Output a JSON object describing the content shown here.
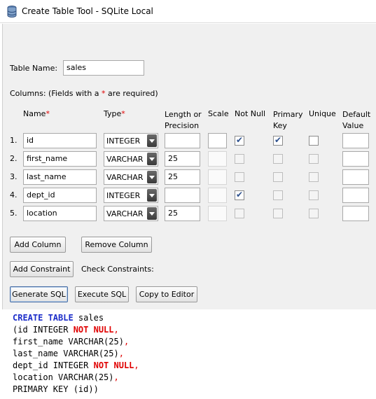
{
  "window": {
    "title": "Create Table Tool - SQLite Local"
  },
  "form": {
    "table_name_label": "Table Name:",
    "table_name_value": "sales",
    "columns_label_prefix": "Columns: (Fields with a ",
    "columns_label_star": "*",
    "columns_label_suffix": " are required)"
  },
  "headers": {
    "name": "Name",
    "type": "Type",
    "required_mark": "*",
    "length_line1": "Length or",
    "length_line2": "Precision",
    "scale": "Scale",
    "not_null": "Not Null",
    "primary_line1": "Primary",
    "primary_line2": "Key",
    "unique": "Unique",
    "default_line1": "Default",
    "default_line2": "Value"
  },
  "rows": [
    {
      "num": "1.",
      "name": "id",
      "type": "INTEGER",
      "length": "",
      "scale": "",
      "not_null": true,
      "primary_key": true,
      "unique": false,
      "default": ""
    },
    {
      "num": "2.",
      "name": "first_name",
      "type": "VARCHAR",
      "length": "25",
      "scale": "",
      "not_null": false,
      "primary_key": false,
      "unique": false,
      "default": ""
    },
    {
      "num": "3.",
      "name": "last_name",
      "type": "VARCHAR",
      "length": "25",
      "scale": "",
      "not_null": false,
      "primary_key": false,
      "unique": false,
      "default": ""
    },
    {
      "num": "4.",
      "name": "dept_id",
      "type": "INTEGER",
      "length": "",
      "scale": "",
      "not_null": true,
      "primary_key": false,
      "unique": false,
      "default": ""
    },
    {
      "num": "5.",
      "name": "location",
      "type": "VARCHAR",
      "length": "25",
      "scale": "",
      "not_null": false,
      "primary_key": false,
      "unique": false,
      "default": ""
    }
  ],
  "buttons": {
    "add_column": "Add Column",
    "remove_column": "Remove Column",
    "add_constraint": "Add Constraint",
    "check_constraints_label": "Check Constraints:",
    "generate_sql": "Generate SQL",
    "execute_sql": "Execute SQL",
    "copy_to_editor": "Copy to Editor"
  },
  "sql_output": {
    "line1_kw": "CREATE TABLE",
    "line1_rest": " sales",
    "line2_a": "(id INTEGER ",
    "line2_nn": "NOT NULL",
    "line2_p": ",",
    "line3_a": "first_name VARCHAR(25)",
    "line3_p": ",",
    "line4_a": "last_name VARCHAR(25)",
    "line4_p": ",",
    "line5_a": "dept_id INTEGER ",
    "line5_nn": "NOT NULL",
    "line5_p": ",",
    "line6_a": "location VARCHAR(25)",
    "line6_p": ",",
    "line7": "PRIMARY KEY (id))"
  },
  "colors": {
    "keyword": "#1c2dc9",
    "not_null": "#e00000",
    "required_star": "#e00000",
    "panel_bg": "#f0f0f0"
  },
  "icons": {
    "app": "database-icon",
    "dropdown": "chevron-down-icon",
    "check": "checkmark-icon"
  }
}
